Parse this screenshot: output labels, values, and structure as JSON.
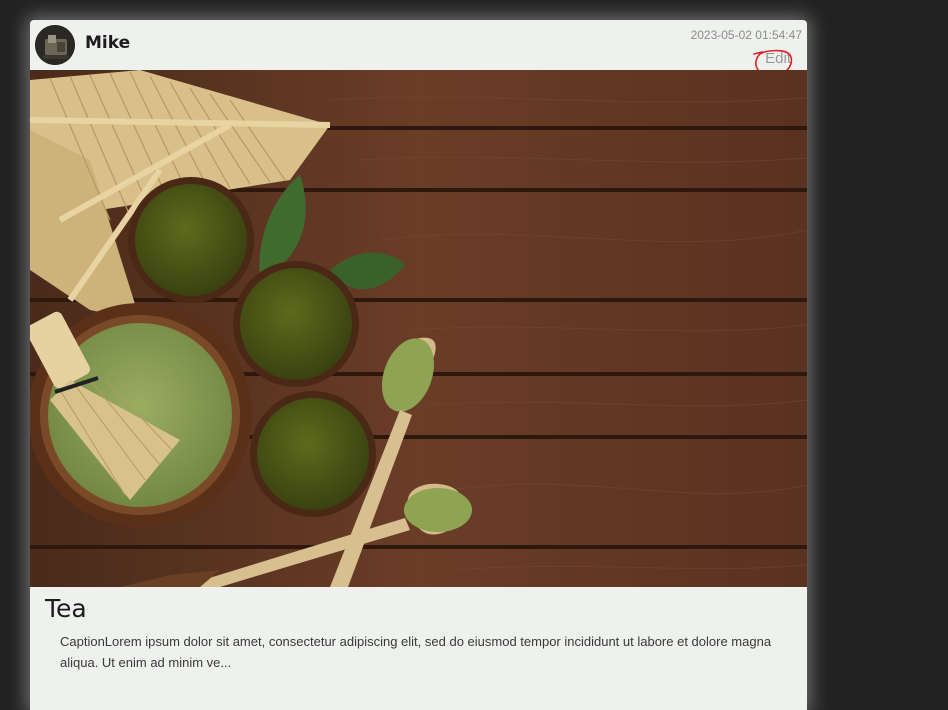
{
  "post": {
    "author": "Mike",
    "timestamp": "2023-05-02 01:54:47",
    "edit_label": "Edit",
    "title": "Tea",
    "caption": "CaptionLorem ipsum dolor sit amet, consectetur adipiscing elit, sed do eiusmod tempor incididunt ut labore et dolore magna aliqua. Ut enim ad minim ve..."
  },
  "colors": {
    "page_background": "#222222",
    "card_background": "#eef1ed",
    "annotation_red": "#e02020"
  }
}
